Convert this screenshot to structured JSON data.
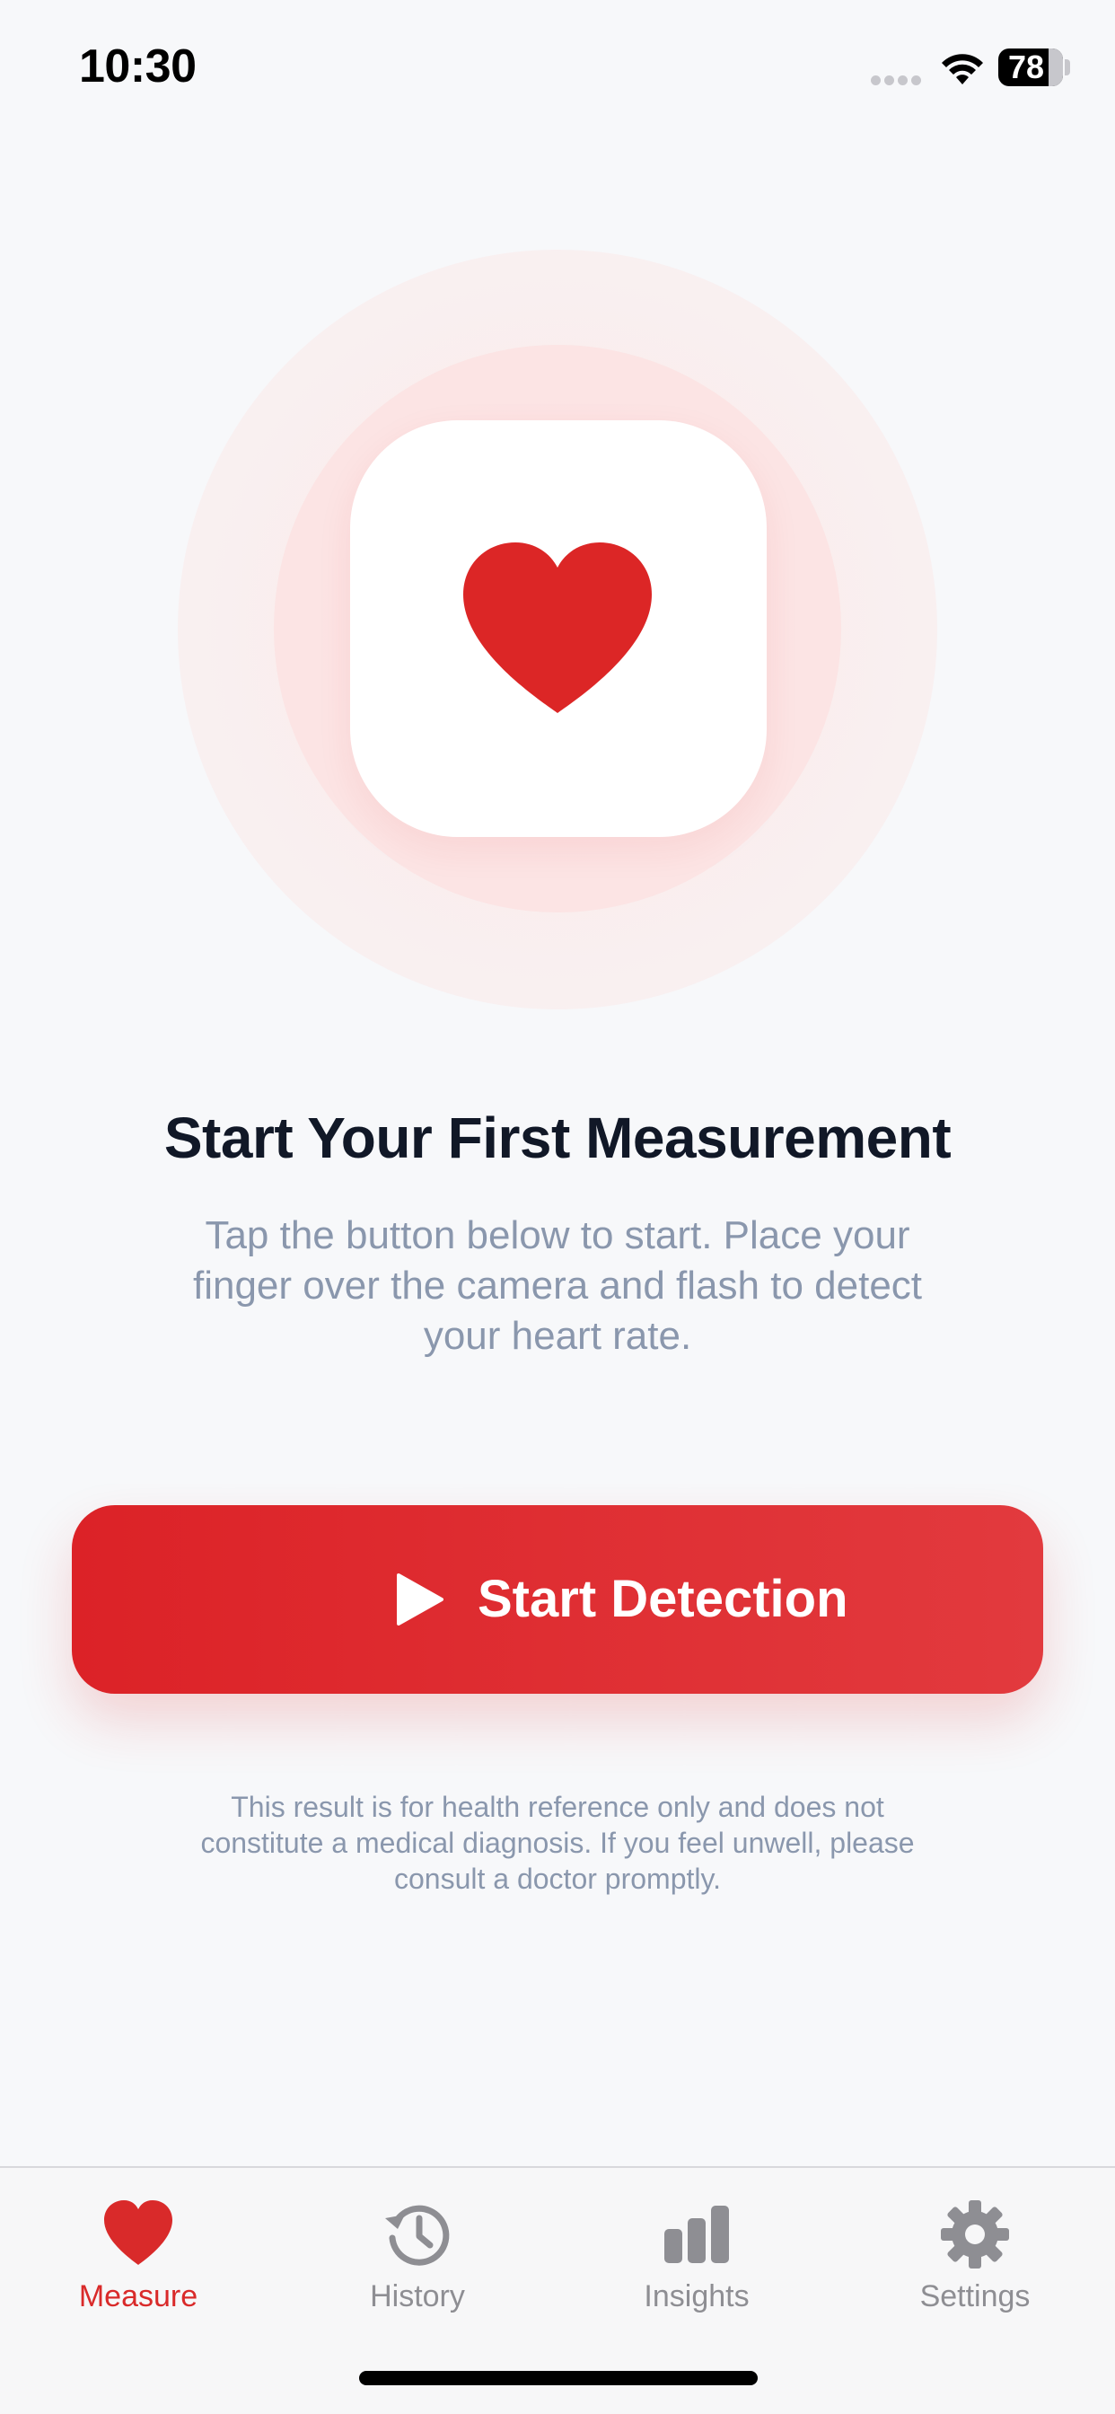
{
  "status_bar": {
    "time": "10:30",
    "battery": "78"
  },
  "hero": {
    "icon": "heart-icon",
    "accent_color": "#dc2626"
  },
  "content": {
    "title": "Start Your First Measurement",
    "subtitle": "Tap the button below to start. Place your finger over the camera and flash to detect your heart rate.",
    "start_button_label": "Start Detection",
    "start_button_icon": "play-icon",
    "disclaimer": "This result is for health reference only and does not constitute a medical diagnosis. If you feel unwell, please consult a doctor promptly."
  },
  "tab_bar": {
    "active": "Measure",
    "active_color": "#d92a2a",
    "inactive_color": "#8e8e93",
    "tabs": [
      {
        "label": "Measure",
        "icon": "heart-icon"
      },
      {
        "label": "History",
        "icon": "history-icon"
      },
      {
        "label": "Insights",
        "icon": "bar-chart-icon"
      },
      {
        "label": "Settings",
        "icon": "gear-icon"
      }
    ]
  }
}
